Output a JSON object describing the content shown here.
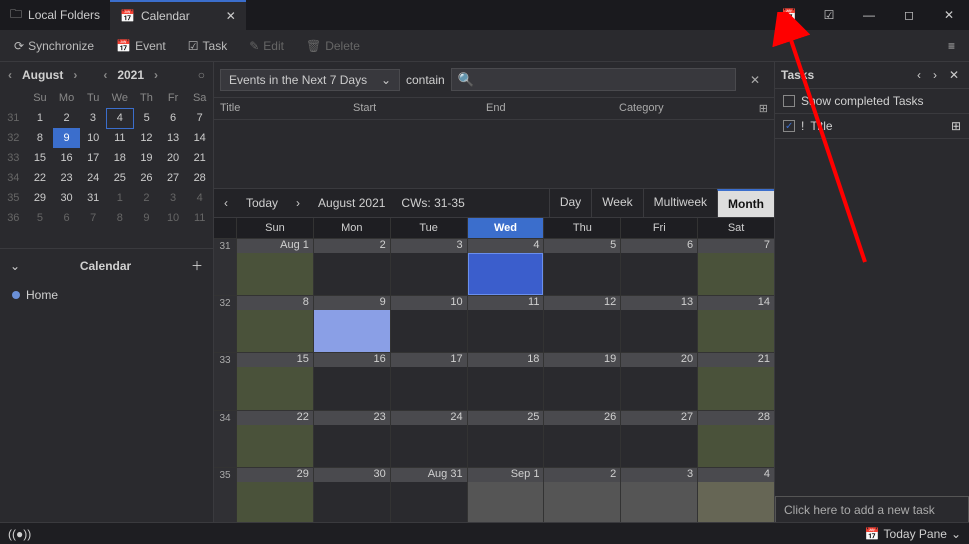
{
  "titlebar": {
    "folder_tab": "Local Folders",
    "calendar_tab": "Calendar"
  },
  "toolbar": {
    "sync": "Synchronize",
    "event": "Event",
    "task": "Task",
    "edit": "Edit",
    "delete": "Delete"
  },
  "mini_cal": {
    "month": "August",
    "year": "2021",
    "dow": [
      "Su",
      "Mo",
      "Tu",
      "We",
      "Th",
      "Fr",
      "Sa"
    ],
    "weeks": [
      {
        "wk": "31",
        "days": [
          "1",
          "2",
          "3",
          "4",
          "5",
          "6",
          "7"
        ],
        "today_idx": 3
      },
      {
        "wk": "32",
        "days": [
          "8",
          "9",
          "10",
          "11",
          "12",
          "13",
          "14"
        ],
        "sel_idx": 1
      },
      {
        "wk": "33",
        "days": [
          "15",
          "16",
          "17",
          "18",
          "19",
          "20",
          "21"
        ]
      },
      {
        "wk": "34",
        "days": [
          "22",
          "23",
          "24",
          "25",
          "26",
          "27",
          "28"
        ]
      },
      {
        "wk": "35",
        "days": [
          "29",
          "30",
          "31",
          "1",
          "2",
          "3",
          "4"
        ],
        "dim_from": 3
      },
      {
        "wk": "36",
        "days": [
          "5",
          "6",
          "7",
          "8",
          "9",
          "10",
          "11"
        ],
        "all_dim": true
      }
    ]
  },
  "cal_section": {
    "title": "Calendar",
    "items": [
      "Home"
    ]
  },
  "filter": {
    "dropdown": "Events in the Next 7 Days",
    "contain": "contain",
    "search_icon": "🔍"
  },
  "list_headers": [
    "Title",
    "Start",
    "End",
    "Category"
  ],
  "viewbar": {
    "today": "Today",
    "context": "August 2021",
    "cws": "CWs: 31-35",
    "tabs": [
      "Day",
      "Week",
      "Multiweek",
      "Month"
    ],
    "active_tab": 3
  },
  "month_view": {
    "dow": [
      "Sun",
      "Mon",
      "Tue",
      "Wed",
      "Thu",
      "Fri",
      "Sat"
    ],
    "today_col": 3,
    "rows": [
      {
        "wk": "31",
        "cells": [
          {
            "n": "Aug 1",
            "weekend": true
          },
          {
            "n": "2"
          },
          {
            "n": "3"
          },
          {
            "n": "4",
            "today": true
          },
          {
            "n": "5"
          },
          {
            "n": "6"
          },
          {
            "n": "7",
            "weekend": true
          }
        ]
      },
      {
        "wk": "32",
        "cells": [
          {
            "n": "8",
            "weekend": true
          },
          {
            "n": "9",
            "sel": true
          },
          {
            "n": "10"
          },
          {
            "n": "11"
          },
          {
            "n": "12"
          },
          {
            "n": "13"
          },
          {
            "n": "14",
            "weekend": true
          }
        ]
      },
      {
        "wk": "33",
        "cells": [
          {
            "n": "15",
            "weekend": true
          },
          {
            "n": "16"
          },
          {
            "n": "17"
          },
          {
            "n": "18"
          },
          {
            "n": "19"
          },
          {
            "n": "20"
          },
          {
            "n": "21",
            "weekend": true
          }
        ]
      },
      {
        "wk": "34",
        "cells": [
          {
            "n": "22",
            "weekend": true
          },
          {
            "n": "23"
          },
          {
            "n": "24"
          },
          {
            "n": "25"
          },
          {
            "n": "26"
          },
          {
            "n": "27"
          },
          {
            "n": "28",
            "weekend": true
          }
        ]
      },
      {
        "wk": "35",
        "cells": [
          {
            "n": "29",
            "weekend": true
          },
          {
            "n": "30"
          },
          {
            "n": "Aug 31"
          },
          {
            "n": "Sep 1",
            "out": true
          },
          {
            "n": "2",
            "out": true
          },
          {
            "n": "3",
            "out": true
          },
          {
            "n": "4",
            "out": true,
            "weekend": true
          }
        ]
      }
    ]
  },
  "tasks_pane": {
    "title": "Tasks",
    "show_completed": "Show completed Tasks",
    "col_title": "Title",
    "add_hint": "Click here to add a new task"
  },
  "statusbar": {
    "today_pane": "Today Pane"
  }
}
